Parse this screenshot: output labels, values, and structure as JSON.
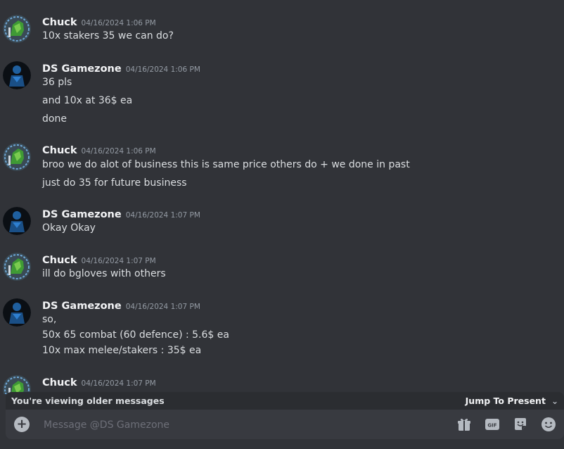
{
  "colors": {
    "background": "#313338",
    "composer": "#383a40",
    "bar": "#2b2d31",
    "author": "#f2f3f5",
    "timestamp": "#949ba4"
  },
  "messages": [
    {
      "author": "Chuck",
      "timestamp": "04/16/2024 1:06 PM",
      "avatar": "green-character-avatar",
      "lines": [
        "10x stakers 35 we can do?"
      ]
    },
    {
      "author": "DS Gamezone",
      "timestamp": "04/16/2024 1:06 PM",
      "avatar": "blue-figure-avatar",
      "lines": [
        "36 pls",
        "and 10x at 36$ ea",
        "done"
      ]
    },
    {
      "author": "Chuck",
      "timestamp": "04/16/2024 1:06 PM",
      "avatar": "green-character-avatar",
      "lines": [
        "broo we do alot of business this is same price others do + we done in past",
        "just do 35 for future business"
      ]
    },
    {
      "author": "DS Gamezone",
      "timestamp": "04/16/2024 1:07 PM",
      "avatar": "blue-figure-avatar",
      "lines": [
        "Okay Okay"
      ]
    },
    {
      "author": "Chuck",
      "timestamp": "04/16/2024 1:07 PM",
      "avatar": "green-character-avatar",
      "lines": [
        "ill do bgloves with others"
      ]
    },
    {
      "author": "DS Gamezone",
      "timestamp": "04/16/2024 1:07 PM",
      "avatar": "blue-figure-avatar",
      "lines": [
        "so,",
        "50x 65 combat (60 defence) : 5.6$ ea",
        "10x max melee/stakers : 35$ ea"
      ]
    },
    {
      "author": "Chuck",
      "timestamp": "04/16/2024 1:07 PM",
      "avatar": "green-character-avatar",
      "lines": []
    }
  ],
  "older_bar": {
    "text": "You're viewing older messages",
    "jump_label": "Jump To Present"
  },
  "composer": {
    "placeholder": "Message @DS Gamezone",
    "tools": [
      "gift-icon",
      "gif-icon",
      "sticker-icon",
      "emoji-icon"
    ]
  }
}
